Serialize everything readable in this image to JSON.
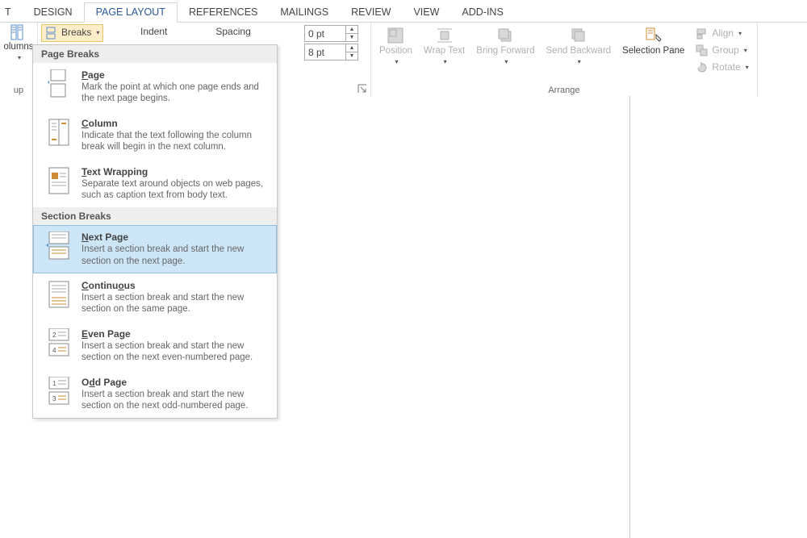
{
  "tabs": {
    "partial": "T",
    "design": "DESIGN",
    "page_layout": "PAGE LAYOUT",
    "references": "REFERENCES",
    "mailings": "MAILINGS",
    "review": "REVIEW",
    "view": "VIEW",
    "addins": "ADD-INS"
  },
  "ribbon": {
    "columns": {
      "label": "olumns",
      "group": "up"
    },
    "breaks": "Breaks",
    "indent": "Indent",
    "spacing": "Spacing",
    "before": "0 pt",
    "after": "8 pt",
    "arrange": {
      "position": "Position",
      "wrap": "Wrap Text",
      "bring": "Bring Forward",
      "send": "Send Backward",
      "selection": "Selection Pane",
      "align": "Align",
      "group": "Group",
      "rotate": "Rotate",
      "label": "Arrange"
    }
  },
  "dropdown": {
    "h1": "Page Breaks",
    "page": {
      "t": "Page",
      "d": "Mark the point at which one page ends and the next page begins."
    },
    "column": {
      "t": "Column",
      "d": "Indicate that the text following the column break will begin in the next column."
    },
    "wrap": {
      "t": "Text Wrapping",
      "d": "Separate text around objects on web pages, such as caption text from body text."
    },
    "h2": "Section Breaks",
    "next": {
      "t": "Next Page",
      "d": "Insert a section break and start the new section on the next page."
    },
    "cont": {
      "t": "Continuous",
      "d": "Insert a section break and start the new section on the same page."
    },
    "even": {
      "t": "Even Page",
      "d": "Insert a section break and start the new section on the next even-numbered page."
    },
    "odd": {
      "t": "Odd Page",
      "d": "Insert a section break and start the new section on the next odd-numbered page."
    }
  }
}
